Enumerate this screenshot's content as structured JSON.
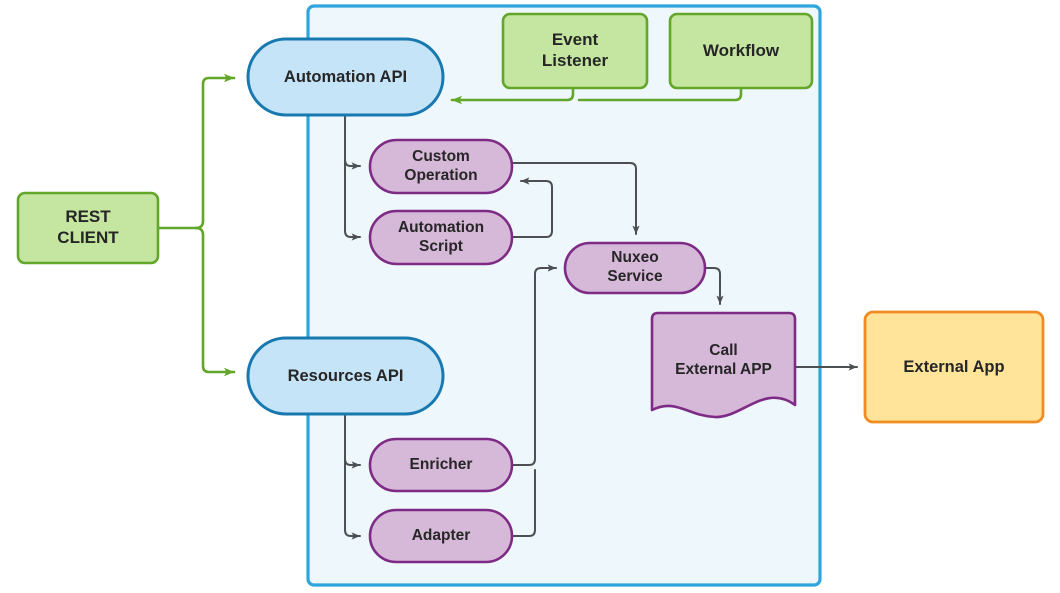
{
  "diagram": {
    "title": "Nuxeo REST/Automation architecture diagram",
    "colors": {
      "panel_fill": "#eef7fb",
      "panel_stroke": "#2fa5dd",
      "blue_fill": "#c5e4f7",
      "blue_stroke": "#1878b0",
      "green_fill": "#c5e6a0",
      "green_stroke": "#62a62a",
      "purple_fill": "#d6b8d8",
      "purple_stroke": "#7e2b85",
      "orange_fill": "#ffe49a",
      "orange_stroke": "#f08c21",
      "arrow_gray": "#4d5053",
      "arrow_green": "#62a62a"
    }
  },
  "nodes": {
    "rest_client": {
      "label": "REST\nCLIENT",
      "shape": "rectangle",
      "color": "green"
    },
    "automation_api": {
      "label": "Automation API",
      "shape": "stadium",
      "color": "blue"
    },
    "resources_api": {
      "label": "Resources API",
      "shape": "stadium",
      "color": "blue"
    },
    "event_listener": {
      "label": "Event\nListener",
      "shape": "rectangle",
      "color": "green"
    },
    "workflow": {
      "label": "Workflow",
      "shape": "rectangle",
      "color": "green"
    },
    "custom_operation": {
      "label": "Custom\nOperation",
      "shape": "stadium",
      "color": "purple"
    },
    "automation_script": {
      "label": "Automation\nScript",
      "shape": "stadium",
      "color": "purple"
    },
    "enricher": {
      "label": "Enricher",
      "shape": "stadium",
      "color": "purple"
    },
    "adapter": {
      "label": "Adapter",
      "shape": "stadium",
      "color": "purple"
    },
    "nuxeo_service": {
      "label": "Nuxeo\nService",
      "shape": "stadium",
      "color": "purple"
    },
    "call_external_app": {
      "label": "Call\nExternal APP",
      "shape": "document",
      "color": "purple"
    },
    "external_app": {
      "label": "External App",
      "shape": "rectangle",
      "color": "orange"
    }
  },
  "edges": [
    {
      "from": "rest_client",
      "to": "automation_api",
      "color": "green"
    },
    {
      "from": "rest_client",
      "to": "resources_api",
      "color": "green"
    },
    {
      "from": "event_listener",
      "to": "automation_api",
      "color": "green"
    },
    {
      "from": "workflow",
      "to": "automation_api",
      "color": "green"
    },
    {
      "from": "automation_api",
      "to": "custom_operation",
      "color": "gray"
    },
    {
      "from": "automation_api",
      "to": "automation_script",
      "color": "gray"
    },
    {
      "from": "automation_script",
      "to": "custom_operation",
      "color": "gray"
    },
    {
      "from": "custom_operation",
      "to": "nuxeo_service",
      "color": "gray"
    },
    {
      "from": "resources_api",
      "to": "enricher",
      "color": "gray"
    },
    {
      "from": "resources_api",
      "to": "adapter",
      "color": "gray"
    },
    {
      "from": "enricher",
      "to": "nuxeo_service",
      "color": "gray"
    },
    {
      "from": "adapter",
      "to": "nuxeo_service",
      "color": "gray"
    },
    {
      "from": "nuxeo_service",
      "to": "call_external_app",
      "color": "gray"
    },
    {
      "from": "call_external_app",
      "to": "external_app",
      "color": "gray"
    }
  ]
}
